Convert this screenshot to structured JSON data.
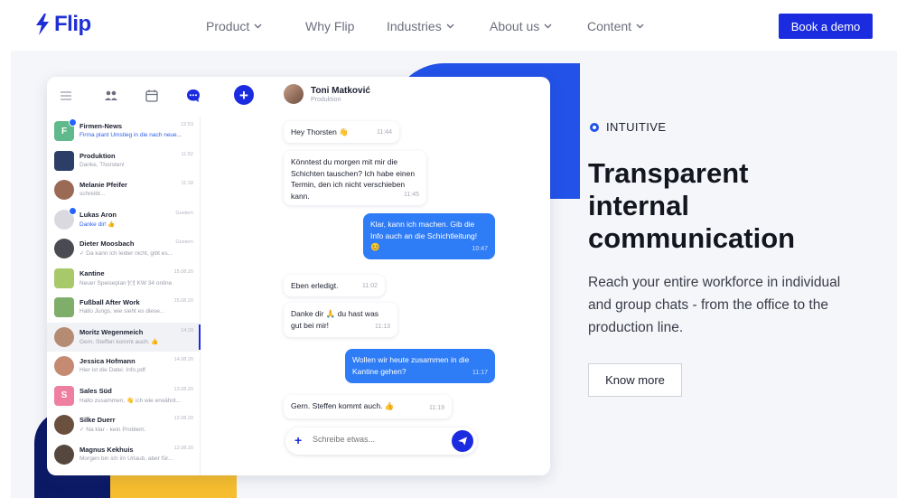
{
  "brand": {
    "name": "Flip",
    "color": "#1f2fd6"
  },
  "nav": {
    "items": [
      {
        "label": "Product",
        "dropdown": true
      },
      {
        "label": "Why Flip",
        "dropdown": false
      },
      {
        "label": "Industries",
        "dropdown": true
      },
      {
        "label": "About us",
        "dropdown": true
      },
      {
        "label": "Content",
        "dropdown": true
      }
    ],
    "cta": "Book a demo"
  },
  "app": {
    "toolbar_icons": [
      "menu-icon",
      "people-icon",
      "calendar-icon",
      "chat-icon",
      "plus-icon"
    ],
    "conversations": [
      {
        "name": "Firmen-News",
        "preview": "Firma plant Umstieg in die nach neue...",
        "time": "12:53",
        "unread": true,
        "preview_blue": true,
        "avatar_color": "#5fb98a",
        "avatar_letter": "F",
        "square": true
      },
      {
        "name": "Produktion",
        "preview": "Danke, Thorsten!",
        "time": "11:52",
        "unread": false,
        "preview_blue": false,
        "avatar_color": "#2c3e66",
        "avatar_letter": "",
        "square": true
      },
      {
        "name": "Melanie Pfeifer",
        "preview": "schreibt...",
        "time": "11:18",
        "unread": false,
        "preview_blue": false,
        "avatar_color": "#9b6a55",
        "avatar_letter": "",
        "square": false
      },
      {
        "name": "Lukas Aron",
        "preview": "Danke dir! 👍",
        "time": "Gestern",
        "unread": true,
        "preview_blue": true,
        "avatar_color": "#d9d9df",
        "avatar_letter": "",
        "square": false
      },
      {
        "name": "Dieter Moosbach",
        "preview": "✓ Da kann ich leider nicht, gibt es...",
        "time": "Gestern",
        "unread": false,
        "preview_blue": false,
        "avatar_color": "#4a4a52",
        "avatar_letter": "",
        "square": false
      },
      {
        "name": "Kantine",
        "preview": "Neuer Speiseplan 🍽 KW 34 online",
        "time": "15.08.20",
        "unread": false,
        "preview_blue": false,
        "avatar_color": "#a8c96a",
        "avatar_letter": "",
        "square": true
      },
      {
        "name": "Fußball After Work",
        "preview": "Hallo Jungs, wie sieht es diese...",
        "time": "15.08.20",
        "unread": false,
        "preview_blue": false,
        "avatar_color": "#7fae6a",
        "avatar_letter": "",
        "square": true
      },
      {
        "name": "Moritz Wegenmeich",
        "preview": "Gern. Steffen kommt auch. 👍",
        "time": "14:28",
        "unread": false,
        "preview_blue": false,
        "avatar_color": "#b58b74",
        "avatar_letter": "",
        "square": false,
        "active": true
      },
      {
        "name": "Jessica Hofmann",
        "preview": "Hier ist die Datei: Info.pdf",
        "time": "14.08.20",
        "unread": false,
        "preview_blue": false,
        "avatar_color": "#c48a72",
        "avatar_letter": "",
        "square": false
      },
      {
        "name": "Sales Süd",
        "preview": "Hallo zusammen, 👋 ich wie erwähnt...",
        "time": "13.08.20",
        "unread": false,
        "preview_blue": false,
        "avatar_color": "#ef7fa0",
        "avatar_letter": "S",
        "square": true
      },
      {
        "name": "Silke Duerr",
        "preview": "✓ Na klar - kein Problem.",
        "time": "12.08.20",
        "unread": false,
        "preview_blue": false,
        "avatar_color": "#6b5040",
        "avatar_letter": "",
        "square": false
      },
      {
        "name": "Magnus Kekhuis",
        "preview": "Morgen bin ich im Urlaub, aber für...",
        "time": "12.08.20",
        "unread": false,
        "preview_blue": false,
        "avatar_color": "#55463e",
        "avatar_letter": "",
        "square": false
      }
    ],
    "chat": {
      "name": "Toni Matković",
      "subtitle": "Produktion",
      "messages": [
        {
          "dir": "in",
          "text": "Hey Thorsten 👋",
          "time": "11:44"
        },
        {
          "dir": "in",
          "text": "Könntest du morgen mit mir die Schichten tauschen? Ich habe einen Termin, den ich nicht verschieben kann.",
          "time": "11:45"
        },
        {
          "dir": "out",
          "text": "Klar, kann ich machen. Gib die Info auch an die Schichtleitung! 😊",
          "time": "10:47"
        },
        {
          "dir": "in",
          "text": "Eben erledigt.",
          "time": "11:02"
        },
        {
          "dir": "in",
          "text": "Danke dir 🙏 du hast was gut bei mir!",
          "time": "11:13"
        },
        {
          "dir": "out",
          "text": "Wollen wir heute zusammen in die Kantine gehen?",
          "time": "11:17"
        },
        {
          "dir": "in",
          "text": "Gern. Steffen kommt auch. 👍",
          "time": "11:19"
        }
      ],
      "compose_placeholder": "Schreibe etwas..."
    }
  },
  "feature": {
    "eyebrow": "INTUITIVE",
    "headline_lines": [
      "Transparent",
      "internal",
      "communication"
    ],
    "body": "Reach your entire workforce in individual and group chats - from the office to the production line.",
    "button": "Know more"
  },
  "colors": {
    "accent": "#1a2be0",
    "bubble_out": "#2e7cf6",
    "deco_blue": "#2352e8",
    "deco_navy": "#0c1a66",
    "deco_yellow": "#f6be2e"
  }
}
